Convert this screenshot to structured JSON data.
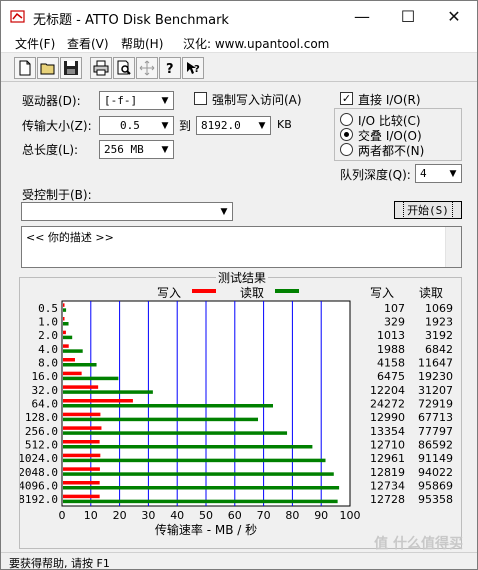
{
  "window": {
    "title": "无标题 - ATTO Disk Benchmark",
    "minimize": "—",
    "maximize": "☐",
    "close": "✕"
  },
  "menu": [
    "文件(F)",
    "查看(V)",
    "帮助(H)",
    "汉化: www.upantool.com"
  ],
  "toolbar": [
    "new-icon",
    "open-icon",
    "save-icon",
    "print-icon",
    "preview-icon",
    "move-icon",
    "help-icon",
    "context-help-icon"
  ],
  "settings": {
    "drive_label": "驱动器(D):",
    "drive_value": "[-f-]",
    "transfer_label": "传输大小(Z):",
    "transfer_from": "0.5",
    "transfer_to_label": "到",
    "transfer_to": "8192.0",
    "transfer_unit": "KB",
    "length_label": "总长度(L):",
    "length_value": "256 MB",
    "force_write_label": "强制写入访问(A)",
    "direct_io_label": "直接 I/O(R)",
    "radio_compare": "I/O 比较(C)",
    "radio_overlap": "交叠 I/O(O)",
    "radio_neither": "两者都不(N)",
    "queue_label": "队列深度(Q):",
    "queue_value": "4",
    "controlled_by_label": "受控制于(B):",
    "controlled_by_value": "",
    "start_button": "开始(S)",
    "description": "<<  你的描述   >>"
  },
  "results": {
    "title": "测试结果",
    "legend_write": "写入",
    "legend_read": "读取",
    "col_write": "写入",
    "col_read": "读取",
    "xlabel": "传输速率 - MB / 秒"
  },
  "chart_data": {
    "type": "bar",
    "categories": [
      "0.5",
      "1.0",
      "2.0",
      "4.0",
      "8.0",
      "16.0",
      "32.0",
      "64.0",
      "128.0",
      "256.0",
      "512.0",
      "1024.0",
      "2048.0",
      "4096.0",
      "8192.0"
    ],
    "series": [
      {
        "name": "写入",
        "values": [
          107,
          329,
          1013,
          1988,
          4158,
          6475,
          12204,
          24272,
          12990,
          13354,
          12710,
          12961,
          12819,
          12734,
          12728
        ]
      },
      {
        "name": "读取",
        "values": [
          1069,
          1923,
          3192,
          6842,
          11647,
          19230,
          31207,
          72919,
          67713,
          77797,
          86592,
          91149,
          94022,
          95869,
          95358
        ]
      }
    ],
    "x_ticks": [
      "0",
      "10",
      "20",
      "30",
      "40",
      "50",
      "60",
      "70",
      "80",
      "90",
      "100"
    ],
    "xlim": [
      0,
      100
    ],
    "x_unit_divisor": 1000,
    "colors": {
      "write": "#ff0000",
      "read": "#008000",
      "grid": "#0000ff"
    },
    "grid": true
  },
  "status": "要获得帮助, 请按 F1",
  "watermark": "值 什么值得买"
}
